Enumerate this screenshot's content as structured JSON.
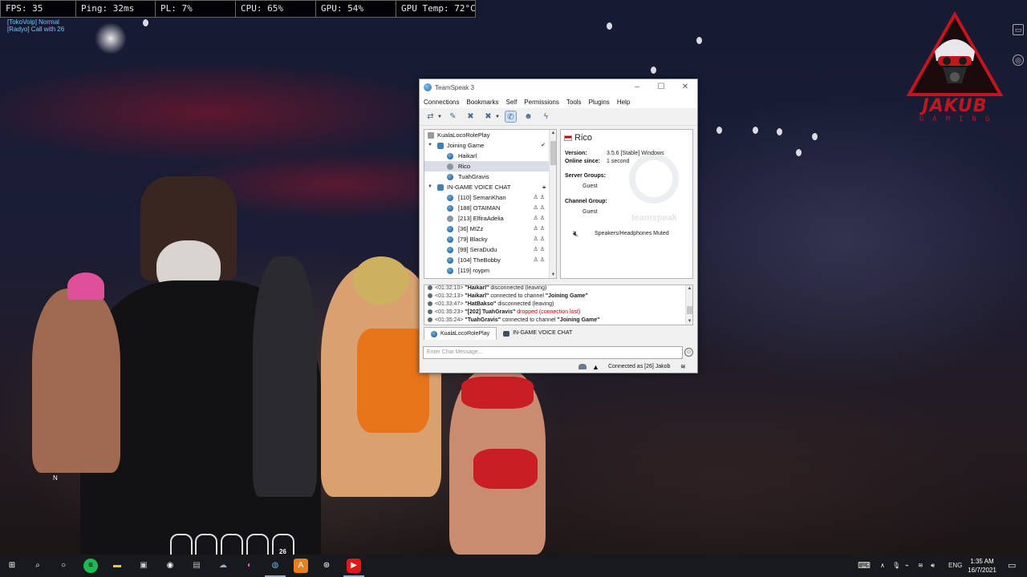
{
  "overlay": {
    "fps": "FPS: 35",
    "ping": "Ping: 32ms",
    "pl": "PL: 7%",
    "cpu": "CPU: 65%",
    "gpu": "GPU: 54%",
    "gpu_temp": "GPU Temp: 72°C",
    "voip_line1": "[TokoVoip] Normal",
    "voip_line2": "[Radyo] Call with 26"
  },
  "logo": {
    "text": "JAKUB",
    "sub": "GAMING"
  },
  "teamspeak": {
    "title": "TeamSpeak 3",
    "menu": [
      "Connections",
      "Bookmarks",
      "Self",
      "Permissions",
      "Tools",
      "Plugins",
      "Help"
    ],
    "toolbar_icons": [
      "connect-icon",
      "disconnect-icon",
      "mute-microphone-icon",
      "mute-speakers-icon",
      "away-icon",
      "contacts-icon",
      "whisper-icon"
    ],
    "tree": {
      "server": "KualaLocoRolePlay",
      "channel1": "Joining Game",
      "channel1_clients": [
        "Haikarl",
        "Rico",
        "TuahGravis"
      ],
      "channel2": "IN-GAME VOICE CHAT",
      "channel2_clients": [
        "[110] SemanKhan",
        "[188] OTAIMAN",
        "[213] ElfiraAdelia",
        "[36] MIZz",
        "[79] Blacky",
        "[99] SeraDudu",
        "[104] TheBobby",
        "[119] roypm"
      ]
    },
    "info": {
      "name": "Rico",
      "version_label": "Version:",
      "version": "3.5.6 [Stable] Windows",
      "online_label": "Online since:",
      "online": "1 second",
      "server_groups_label": "Server Groups:",
      "server_group": "Guest",
      "channel_group_label": "Channel Group:",
      "channel_group": "Guest",
      "status": "Speakers/Headphones Muted",
      "watermark": "teamspeak"
    },
    "log": [
      {
        "time": "<01:32:10>",
        "name": "\"Haikarl\"",
        "text": " disconnected (leaving)"
      },
      {
        "time": "<01:32:13>",
        "name": "\"Haikarl\"",
        "text": " connected to channel ",
        "extra": "\"Joining Game\""
      },
      {
        "time": "<01:33:47>",
        "name": "\"HatBakso\"",
        "text": " disconnected (leaving)"
      },
      {
        "time": "<01:35:23>",
        "name": "\"[202] TuahGravis\"",
        "text": " dropped (connection lost)"
      },
      {
        "time": "<01:35:24>",
        "name": "\"TuahGravis\"",
        "text": " connected to channel ",
        "extra": "\"Joining Game\""
      }
    ],
    "tabs": [
      "KualaLocoRolePlay",
      "IN-GAME VOICE CHAT"
    ],
    "chat_placeholder": "Enter Chat Message...",
    "status": "Connected as [26] Jakob"
  },
  "hud": {
    "slot_count": "26",
    "compass": "N"
  },
  "taskbar": {
    "language": "ENG",
    "time": "1:35 AM",
    "date": "16/7/2021"
  }
}
